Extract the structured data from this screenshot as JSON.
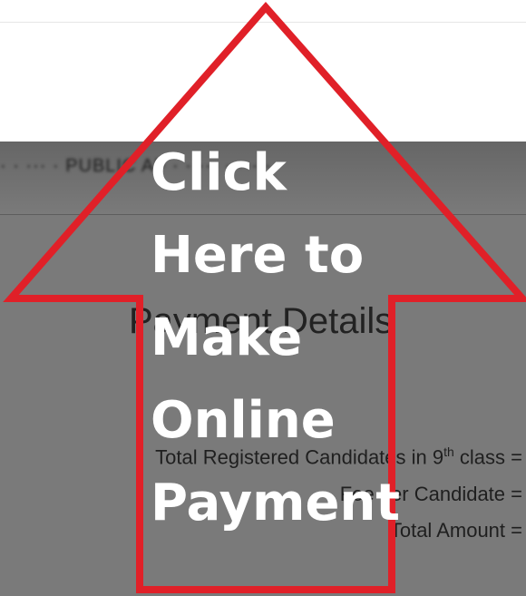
{
  "header": {
    "blurred_text": "· · ··· · PUBLIC AF · · ··· · ··· ·"
  },
  "payment": {
    "heading": "Payment Details",
    "candidates_label": "Total Registered Candidates in 9",
    "candidates_sup": "th",
    "candidates_suffix": " class =",
    "per_candidate_label": "Fee per Candidate =",
    "total_label": "Total Amount ="
  },
  "overlay_arrow": {
    "lines": [
      "Click",
      "Here to",
      "Make",
      "Online",
      "Payment"
    ],
    "stroke_color": "#e02028",
    "text_color": "#ffffff"
  }
}
